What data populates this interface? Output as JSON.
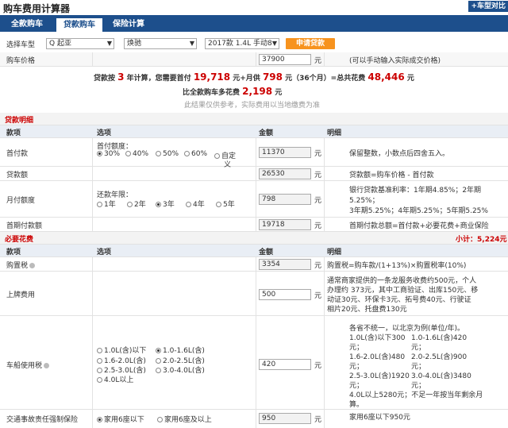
{
  "header": {
    "title": "购车费用计算器",
    "compare_label": "+车型对比"
  },
  "tabs": [
    "全款购车",
    "贷款购车",
    "保险计算"
  ],
  "selector": {
    "label": "选择车型",
    "brand": "Q 起亚",
    "series": "焕驰",
    "model": "2017款 1.4L 手动8",
    "apply_label": "申请贷款"
  },
  "price": {
    "label": "购车价格",
    "value": "37900",
    "unit": "元",
    "hint": "(可以手动输入实际成交价格)"
  },
  "summary": {
    "p1": "贷款按",
    "years": "3",
    "p2": "年计算，您需要首付",
    "down": "19,718",
    "p3": "元+月供",
    "monthly": "798",
    "p4": "元（36个月）=总共花费",
    "total": "48,446",
    "p5": "元",
    "more_p1": "比全款购车多花费",
    "more": "2,198",
    "more_p2": "元",
    "note": "此结果仅供参考，实际费用以当地缴费为准"
  },
  "loan": {
    "section": "贷款明细",
    "head": {
      "item": "款项",
      "option": "选项",
      "amount": "金额",
      "detail": "明细"
    },
    "down": {
      "label": "首付款",
      "sub": "首付额度：",
      "opts": [
        "30%",
        "40%",
        "50%",
        "60%",
        "自定",
        "义"
      ],
      "value": "11370",
      "unit": "元",
      "detail": "保留整数，小数点后四舍五入。"
    },
    "amount": {
      "label": "贷款额",
      "value": "26530",
      "unit": "元",
      "detail": "贷款额=购车价格 - 首付款"
    },
    "monthly": {
      "label": "月付额度",
      "sub": "还款年限：",
      "opts": [
        "1年",
        "2年",
        "3年",
        "4年",
        "5年"
      ],
      "value": "798",
      "unit": "元",
      "d1": "银行贷款基准利率：1年期4.85%；2年期",
      "d2": "5.25%；",
      "d3": "3年期5.25%；4年期5.25%；5年期5.25%"
    },
    "first": {
      "label": "首期付款额",
      "value": "19718",
      "unit": "元",
      "detail": "首期付款总额=首付款+必要花费+商业保险"
    }
  },
  "required": {
    "section": "必要花费",
    "subtotal_label": "小计：",
    "subtotal": "5,224元",
    "head": {
      "item": "款项",
      "option": "选项",
      "amount": "金额",
      "detail": "明细"
    },
    "tax": {
      "label": "购置税",
      "value": "3354",
      "unit": "元",
      "detail": "购置税=购车款/(1+13%)×购置税率(10%)"
    },
    "plate": {
      "label": "上牌费用",
      "value": "500",
      "unit": "元",
      "d1": "通常商家提供的一条龙服务收费约500元，个人",
      "d2": "办理约 373元，其中工商验证、出库150元、移",
      "d3": "动证30元、环保卡3元、拓号费40元、行驶证",
      "d4": "相片20元、托盘费130元"
    },
    "vtax": {
      "label": "车船使用税",
      "value": "420",
      "unit": "元",
      "opts": [
        "1.0L(含)以下",
        "1.0-1.6L(含)",
        "1.6-2.0L(含)",
        "2.0-2.5L(含)",
        "2.5-3.0L(含)",
        "3.0-4.0L(含)",
        "4.0L以上"
      ],
      "d0": "各省不统一，以北京为例(单位/年)。",
      "dl": [
        "1.0L(含)以下300",
        "元；",
        "1.6-2.0L(含)480",
        "元；",
        "2.5-3.0L(含)1920",
        "元；"
      ],
      "dr": [
        "1.0-1.6L(含)420",
        "元；",
        "2.0-2.5L(含)900",
        "元；",
        "3.0-4.0L(含)3480",
        "元；"
      ],
      "d5": "4.0L以上5280元；不足一年按当年剩余月",
      "d6": "算。"
    },
    "insure": {
      "label": "交通事故责任强制保险",
      "opts": [
        "家用6座以下",
        "家用6座及以上"
      ],
      "value": "950",
      "unit": "元",
      "detail": "家用6座以下950元"
    }
  }
}
